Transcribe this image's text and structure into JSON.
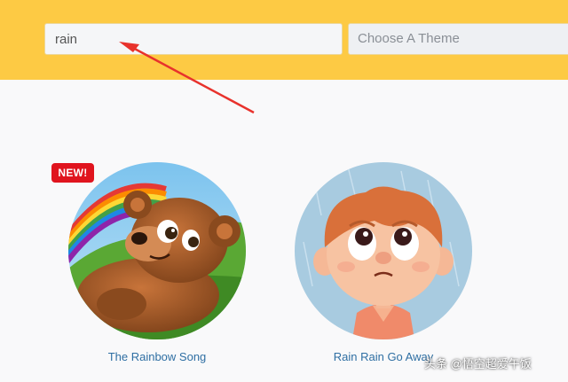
{
  "search": {
    "value": "rain"
  },
  "theme_select": {
    "selected": "Choose A Theme"
  },
  "results": [
    {
      "title": "The Rainbow Song",
      "badge": "NEW!"
    },
    {
      "title": "Rain Rain Go Away"
    }
  ],
  "watermark": "头条 @悟空超爱午饭",
  "colors": {
    "header": "#fdca44",
    "badge": "#e0141e",
    "link": "#2f6fa3",
    "annotation_arrow": "#e8322c"
  }
}
